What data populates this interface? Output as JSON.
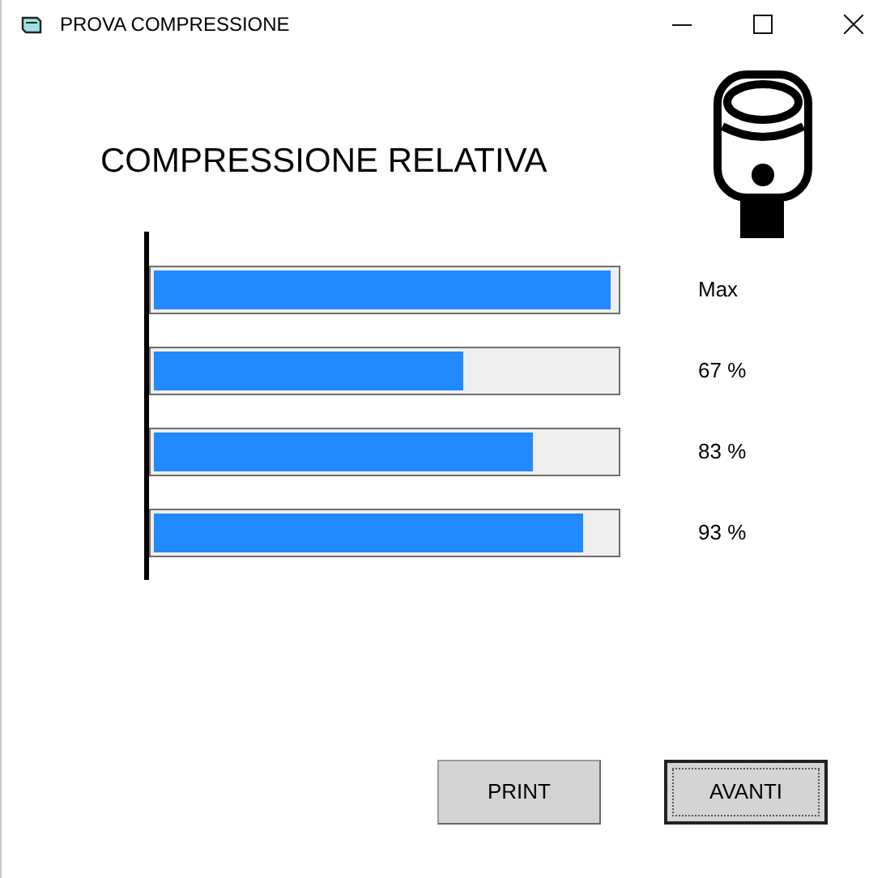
{
  "window": {
    "title": "PROVA COMPRESSIONE"
  },
  "heading": "COMPRESSIONE RELATIVA",
  "bars": [
    {
      "level": 0.99,
      "reading": "Max"
    },
    {
      "level": 0.67,
      "reading": "67 %"
    },
    {
      "level": 0.82,
      "reading": "83 %"
    },
    {
      "level": 0.93,
      "reading": "93 %"
    }
  ],
  "buttons": [
    {
      "label": "PRINT",
      "focused": false
    },
    {
      "label": "AVANTI",
      "focused": true
    }
  ]
}
